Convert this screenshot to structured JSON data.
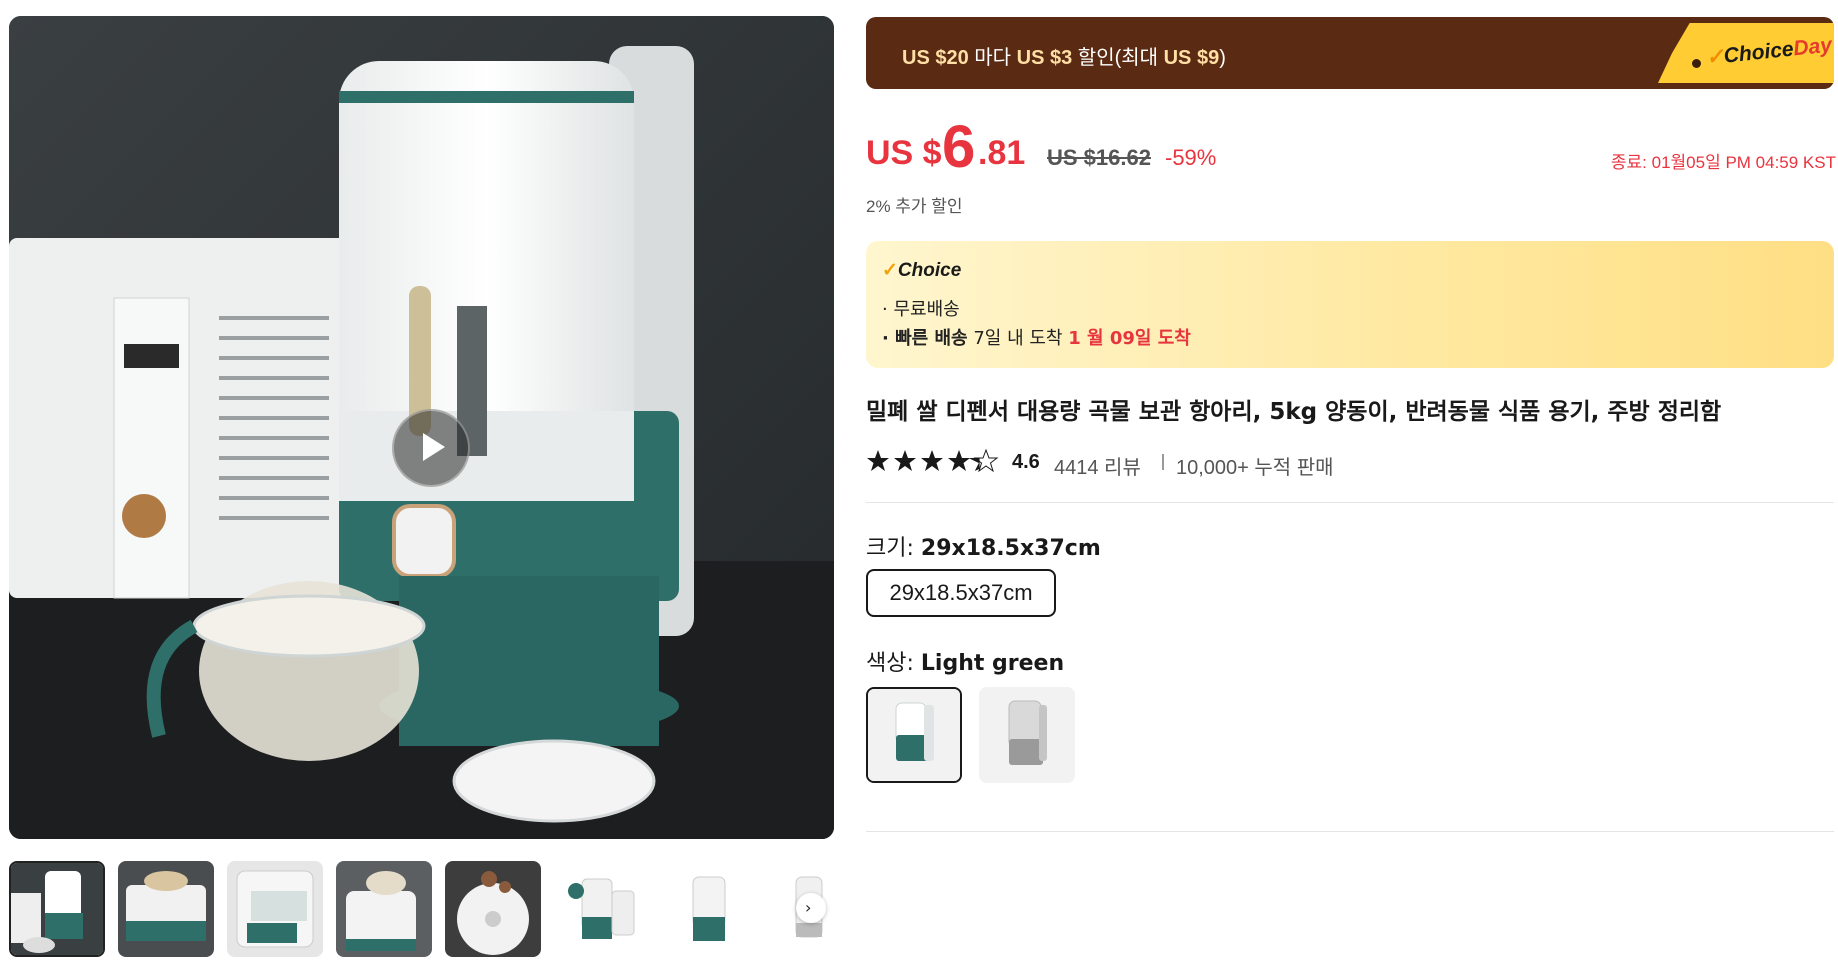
{
  "gallery": {
    "main_image_alt": "rice dispenser",
    "thumbnail_count": 8
  },
  "promo": {
    "amount1": "US $20",
    "text1": " 마다 ",
    "amount2": "US $3",
    "text2": " 할인(최대 ",
    "amount3": "US $9",
    "text3": ")",
    "tag_choice": "Choice",
    "tag_day": "Day"
  },
  "price": {
    "currency": "US $",
    "integer": "6",
    "decimal": ".81",
    "original": "US $16.62",
    "discount": "-59%",
    "ends": "종료: 01월05일 PM 04:59 KST",
    "extra_discount": "2% 추가 할인"
  },
  "choice": {
    "title": "Choice",
    "free_shipping": "· 무료배송",
    "fast_label": "· 빠른 배송",
    "fast_text": " 7일 내 도착 ",
    "fast_date": "1 월 09일 도착"
  },
  "product": {
    "title": "밀폐 쌀 디펜서 대용량 곡물 보관 항아리, 5kg 양동이, 반려동물 식품 용기, 주방 정리함",
    "rating": "4.6",
    "reviews": "4414 리뷰",
    "sold": "10,000+ 누적 판매",
    "stars": 4.6
  },
  "options": {
    "size_label": "크기: ",
    "size_value": "29x18.5x37cm",
    "size_options": [
      "29x18.5x37cm"
    ],
    "color_label": "색상: ",
    "color_value": "Light green",
    "color_options": [
      "Light green",
      "Gray"
    ]
  },
  "colors": {
    "price_red": "#e8343f",
    "promo_brown": "#5a2b12",
    "teal": "#2f6f6a"
  }
}
